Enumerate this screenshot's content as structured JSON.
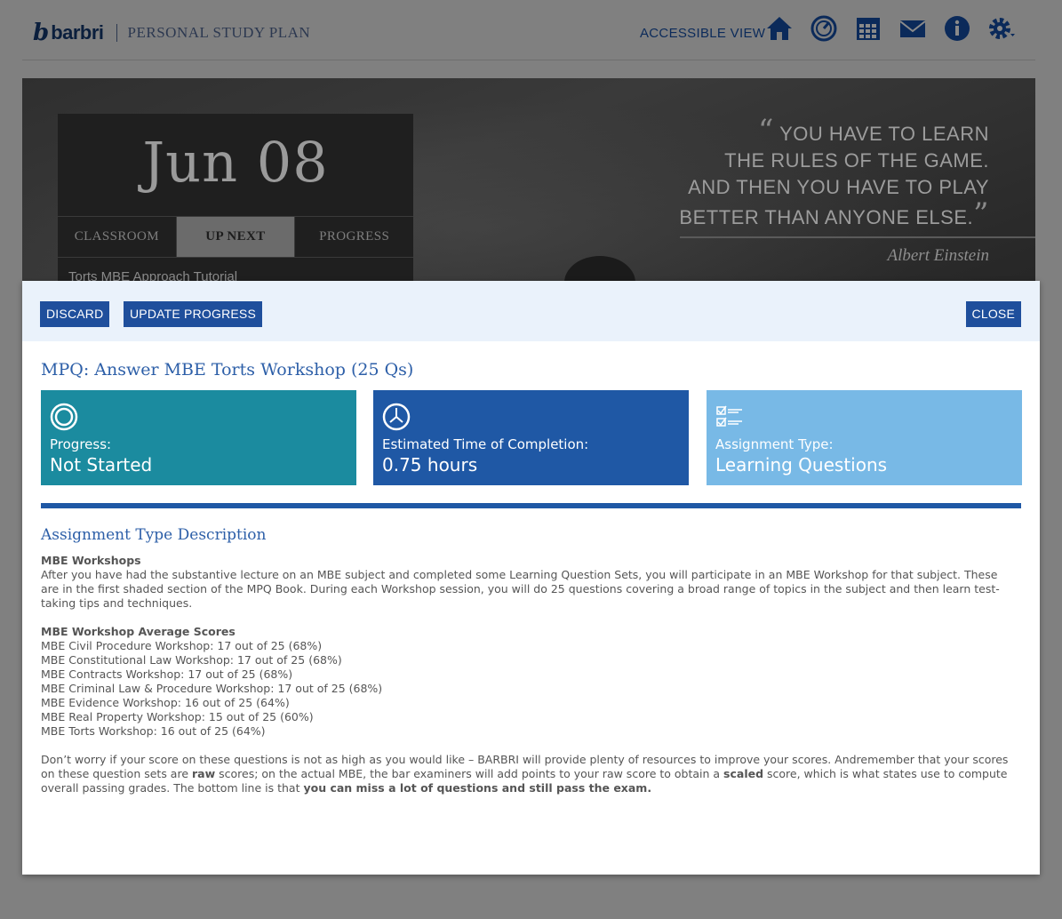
{
  "header": {
    "logo_mark": "b",
    "logo_text": "barbri",
    "subtitle": "PERSONAL STUDY PLAN",
    "accessible_view": "ACCESSIBLE VIEW",
    "icons": [
      "home-icon",
      "dashboard-icon",
      "calendar-icon",
      "mail-icon",
      "info-icon",
      "settings-icon"
    ]
  },
  "hero": {
    "date": "Jun 08",
    "tabs": [
      {
        "label": "CLASSROOM"
      },
      {
        "label": "UP NEXT"
      },
      {
        "label": "PROGRESS"
      }
    ],
    "up_next_item": "Torts MBE Approach Tutorial",
    "quote_lines": [
      "YOU HAVE TO LEARN",
      "THE RULES OF THE GAME.",
      "AND THEN YOU HAVE TO PLAY",
      "BETTER THAN ANYONE ELSE."
    ],
    "quote_author": "Albert Einstein"
  },
  "modal": {
    "discard_label": "DISCARD",
    "update_label": "UPDATE PROGRESS",
    "close_label": "CLOSE",
    "title": "MPQ: Answer MBE Torts Workshop (25 Qs)",
    "tiles": [
      {
        "icon": "progress-icon",
        "label": "Progress:",
        "value": "Not Started",
        "color": "#1b8b9f"
      },
      {
        "icon": "clock-icon",
        "label": "Estimated Time of Completion:",
        "value": "0.75 hours",
        "color": "#1f58a5"
      },
      {
        "icon": "checklist-icon",
        "label": "Assignment Type:",
        "value": "Learning Questions",
        "color": "#78b9e6"
      }
    ],
    "desc_heading": "Assignment Type Description",
    "workshops_heading": "MBE Workshops",
    "workshops_text": "After you have had the substantive lecture on an MBE subject and completed some Learning Question Sets, you will participate in an MBE Workshop for that subject. These are in the first shaded section of the MPQ Book. During each Workshop session, you will do 25 questions covering a broad range of topics in the subject and then learn test-taking tips and techniques.",
    "scores_heading": "MBE Workshop Average Scores",
    "scores": [
      "MBE Civil Procedure Workshop: 17 out of 25 (68%)",
      "MBE Constitutional Law Workshop: 17 out of 25 (68%)",
      "MBE Contracts Workshop: 17 out of 25 (68%)",
      "MBE Criminal Law & Procedure Workshop: 17 out of 25 (68%)",
      "MBE Evidence Workshop: 16 out of 25 (64%)",
      "MBE Real Property Workshop: 15 out of 25 (60%)",
      "MBE Torts Workshop: 16 out of 25 (64%)"
    ],
    "closing": {
      "p1": "Don’t worry if your score on these questions is not as high as you would like – BARBRI will provide plenty of resources to improve your scores. Andremember that your scores on these question sets are ",
      "b1": "raw",
      "p2": " scores; on the actual MBE, the bar examiners will add points to your raw score to obtain a ",
      "b2": "scaled",
      "p3": " score, which is what states use to compute overall passing grades. The bottom line is that ",
      "b3": "you can miss a lot of questions and still pass the exam."
    }
  }
}
